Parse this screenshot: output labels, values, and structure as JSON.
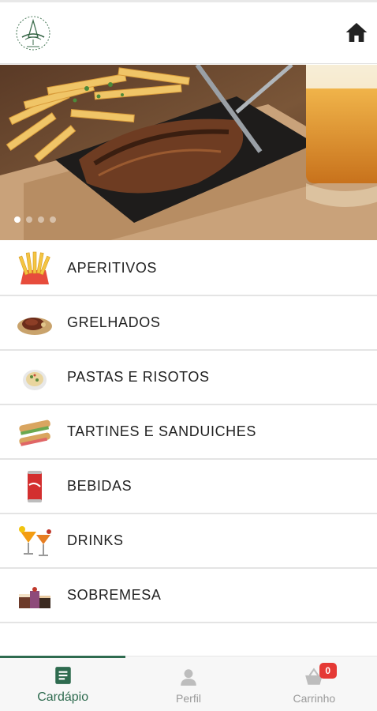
{
  "header": {
    "logo_text": "Brasserie",
    "home_icon": "home-icon"
  },
  "banner": {
    "slides_count": 4,
    "active_slide": 1
  },
  "menu": {
    "items": [
      {
        "label": "APERITIVOS",
        "icon": "fries-icon"
      },
      {
        "label": "GRELHADOS",
        "icon": "steak-icon"
      },
      {
        "label": "PASTAS E RISOTOS",
        "icon": "pasta-icon"
      },
      {
        "label": "TARTINES E SANDUICHES",
        "icon": "sandwich-icon"
      },
      {
        "label": "BEBIDAS",
        "icon": "soda-can-icon"
      },
      {
        "label": "DRINKS",
        "icon": "cocktail-icon"
      },
      {
        "label": "SOBREMESA",
        "icon": "dessert-icon"
      }
    ]
  },
  "bottom_nav": {
    "tabs": [
      {
        "label": "Cardápio",
        "icon": "menu-book-icon",
        "active": true
      },
      {
        "label": "Perfil",
        "icon": "person-icon",
        "active": false
      },
      {
        "label": "Carrinho",
        "icon": "basket-icon",
        "active": false,
        "badge": "0"
      }
    ]
  },
  "colors": {
    "accent": "#2e6b4f",
    "badge": "#e53935",
    "inactive": "#9a9a9a"
  }
}
